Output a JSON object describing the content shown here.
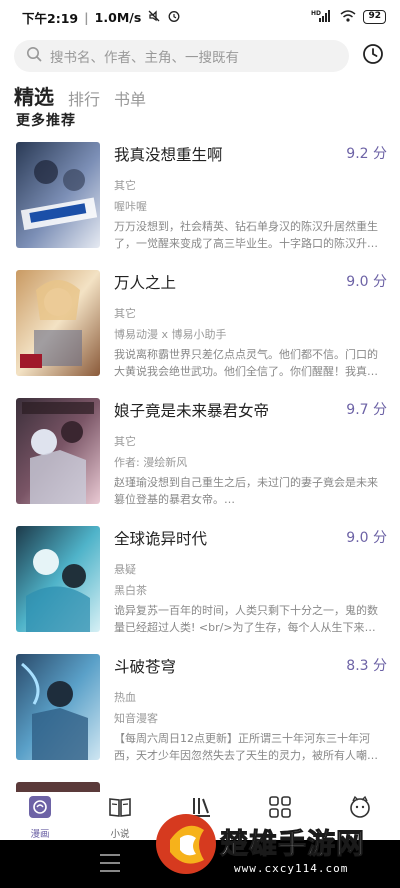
{
  "status_bar": {
    "time": "下午2:19",
    "speed": "1.0M/s",
    "battery": "92",
    "signal_label": "HD"
  },
  "search": {
    "placeholder": "搜书名、作者、主角、一搜既有"
  },
  "tabs": [
    {
      "label": "精选",
      "active": true
    },
    {
      "label": "排行",
      "active": false
    },
    {
      "label": "书单",
      "active": false
    }
  ],
  "section_title": "更多推荐",
  "books": [
    {
      "title": "我真没想重生啊",
      "score": "9.2 分",
      "genre": "其它",
      "author": "喔咔喔",
      "desc": "万万没想到，社会精英、钻石单身汉的陈汉升居然重生了，一觉醒来变成了高三毕业生。十字路口的陈汉升…",
      "cover_colors": [
        "#2a3a55",
        "#7c8fb6",
        "#e6eaf2"
      ]
    },
    {
      "title": "万人之上",
      "score": "9.0 分",
      "genre": "其它",
      "author": "博易动漫 x 博易小助手",
      "desc": "我说离称霸世界只差亿点点灵气。他们都不信。门口的大黄说我会绝世武功。他们全信了。你们醒醒！我真…",
      "cover_colors": [
        "#c99a63",
        "#f3e2c4",
        "#8a5a3a"
      ]
    },
    {
      "title": "娘子竟是未来暴君女帝",
      "score": "9.7 分",
      "genre": "其它",
      "author": "作者: 漫绘新风",
      "desc": "赵瑾瑜没想到自己重生之后，未过门的妻子竟会是未来篡位登基的暴君女帝。…",
      "cover_colors": [
        "#3b2f3a",
        "#7a5566",
        "#e9c9d3"
      ]
    },
    {
      "title": "全球诡异时代",
      "score": "9.0 分",
      "genre": "悬疑",
      "author": "黑白茶",
      "desc": "诡异复苏一百年的时间，人类只剩下十分之一，鬼的数量已经超过人类! <br/>为了生存，每个人从生下来开…",
      "cover_colors": [
        "#1d3a4a",
        "#4fb3c9",
        "#d7f0f5"
      ]
    },
    {
      "title": "斗破苍穹",
      "score": "8.3 分",
      "genre": "热血",
      "author": "知音漫客",
      "desc": "【每周六周日12点更新】正所谓三十年河东三十年河西，天才少年因忽然失去了天生的灵力，被所有人嘲…",
      "cover_colors": [
        "#2a4a6a",
        "#5aa0c8",
        "#cfe6f2"
      ]
    }
  ],
  "bottom_nav": [
    {
      "label": "漫画",
      "icon": "comic-icon",
      "active": true
    },
    {
      "label": "小说",
      "icon": "book-icon",
      "active": false
    },
    {
      "label": "",
      "icon": "bookshelf-icon",
      "active": false
    },
    {
      "label": "",
      "icon": "grid-icon",
      "active": false
    },
    {
      "label": "",
      "icon": "profile-icon",
      "active": false
    }
  ],
  "watermark": {
    "title": "楚雄手游网",
    "url": "www.cxcy114.com"
  },
  "colors": {
    "accent": "#6d63a6",
    "text": "#222222",
    "muted": "#999999"
  }
}
